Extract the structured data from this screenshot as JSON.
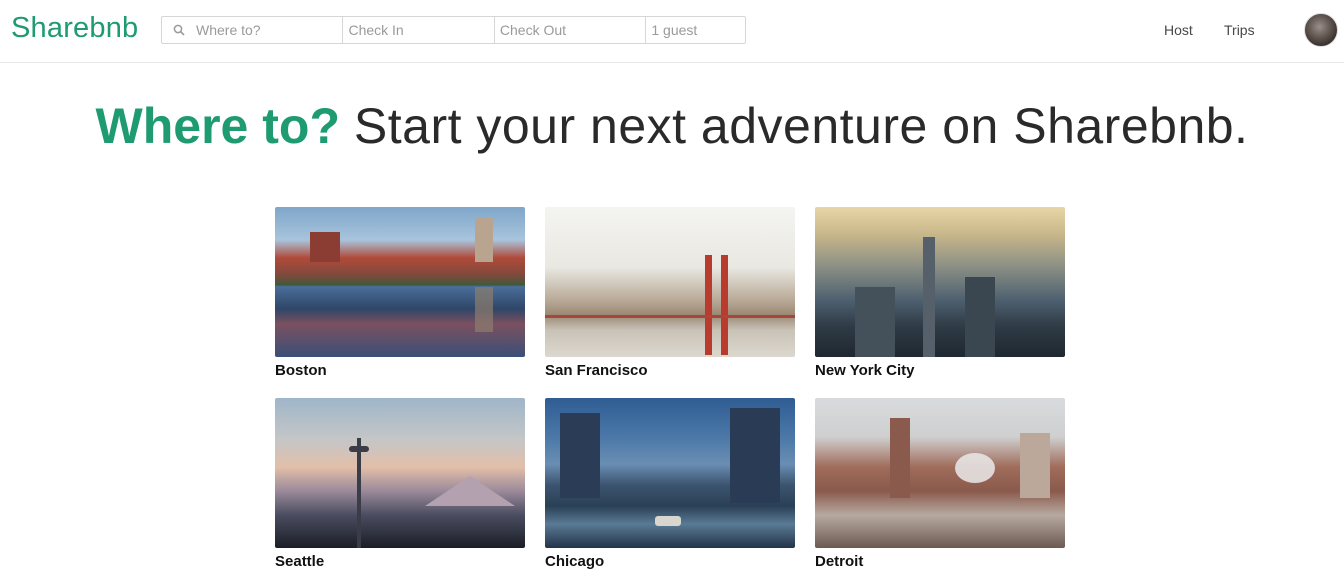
{
  "header": {
    "logo": "Sharebnb",
    "search": {
      "where_placeholder": "Where to?",
      "check_in_placeholder": "Check In",
      "check_out_placeholder": "Check Out",
      "guests_value": "1 guest"
    },
    "nav": {
      "host_label": "Host",
      "trips_label": "Trips"
    }
  },
  "hero": {
    "accent": "Where to?",
    "rest": "Start your next adventure on Sharebnb."
  },
  "destinations": [
    {
      "name": "Boston"
    },
    {
      "name": "San Francisco"
    },
    {
      "name": "New York City"
    },
    {
      "name": "Seattle"
    },
    {
      "name": "Chicago"
    },
    {
      "name": "Detroit"
    }
  ],
  "colors": {
    "brand": "#1f9b72"
  }
}
